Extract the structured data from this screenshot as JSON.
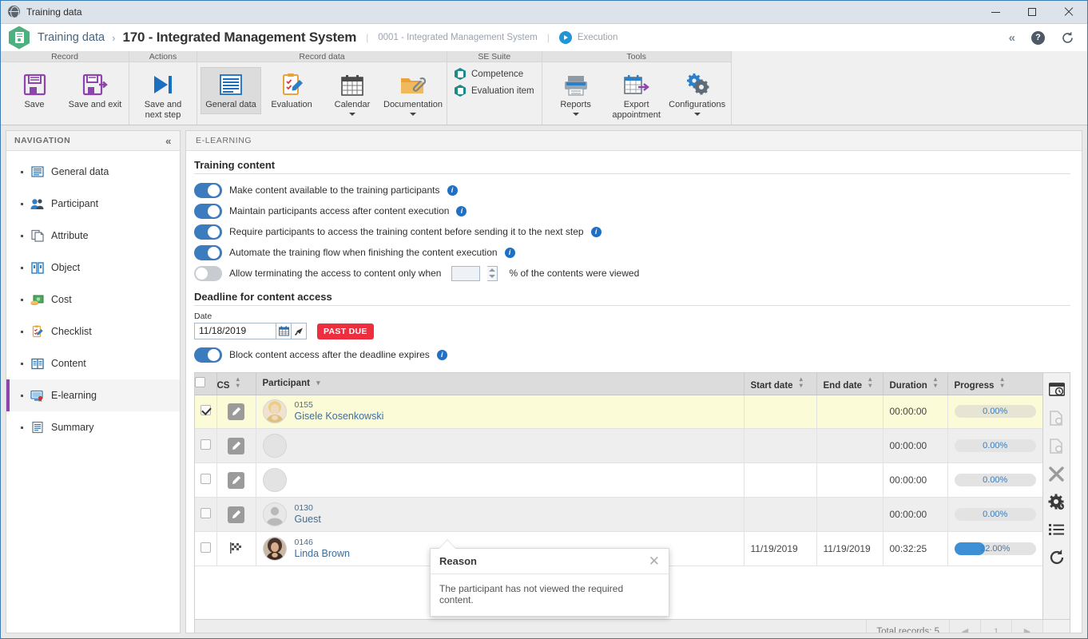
{
  "window": {
    "title": "Training data",
    "icon": "globe-icon",
    "minimize": "minimize",
    "maximize": "maximize",
    "close": "close"
  },
  "header": {
    "breadcrumb_root": "Training data",
    "separator": "›",
    "title": "170 - Integrated Management System",
    "pipe": "|",
    "subtitle": "0001 - Integrated Management System",
    "pipe2": "|",
    "status": "Execution",
    "icons": [
      "chevron-up-icon",
      "help-icon",
      "refresh-icon"
    ]
  },
  "ribbon": {
    "groups": [
      {
        "caption": "Record",
        "buttons": [
          {
            "label": "Save",
            "icon": "save-icon",
            "dropdown": false
          },
          {
            "label": "Save and exit",
            "icon": "save-and-exit-icon",
            "dropdown": false
          }
        ]
      },
      {
        "caption": "Actions",
        "buttons": [
          {
            "label": "Save and next step",
            "icon": "next-step-icon",
            "dropdown": false
          }
        ]
      },
      {
        "caption": "Record data",
        "buttons": [
          {
            "label": "General data",
            "icon": "general-data-icon",
            "dropdown": false,
            "active": true
          },
          {
            "label": "Evaluation",
            "icon": "evaluation-icon",
            "dropdown": false
          },
          {
            "label": "Calendar",
            "icon": "calendar-icon",
            "dropdown": true
          },
          {
            "label": "Documentation",
            "icon": "documentation-icon",
            "dropdown": true
          }
        ]
      },
      {
        "caption": "SE Suite",
        "small_buttons": [
          {
            "label": "Competence",
            "icon": "competence-icon"
          },
          {
            "label": "Evaluation item",
            "icon": "evaluation-item-icon"
          }
        ]
      },
      {
        "caption": "Tools",
        "buttons": [
          {
            "label": "Reports",
            "icon": "reports-icon",
            "dropdown": true
          },
          {
            "label": "Export appointment",
            "icon": "export-appointment-icon",
            "dropdown": false
          },
          {
            "label": "Configurations",
            "icon": "configurations-icon",
            "dropdown": true
          }
        ]
      }
    ]
  },
  "navigation": {
    "title": "NAVIGATION",
    "collapse_icon": "collapse-icon",
    "items": [
      {
        "label": "General data",
        "icon": "general-data-icon",
        "active": false
      },
      {
        "label": "Participant",
        "icon": "participant-icon",
        "active": false
      },
      {
        "label": "Attribute",
        "icon": "attribute-icon",
        "active": false
      },
      {
        "label": "Object",
        "icon": "object-icon",
        "active": false
      },
      {
        "label": "Cost",
        "icon": "cost-icon",
        "active": false
      },
      {
        "label": "Checklist",
        "icon": "checklist-icon",
        "active": false
      },
      {
        "label": "Content",
        "icon": "content-icon",
        "active": false
      },
      {
        "label": "E-learning",
        "icon": "elearning-icon",
        "active": true
      },
      {
        "label": "Summary",
        "icon": "summary-icon",
        "active": false
      }
    ]
  },
  "panel": {
    "tab_label": "E-LEARNING",
    "section_training_content": "Training content",
    "toggles": [
      {
        "label": "Make content available to the training participants",
        "on": true,
        "info": true
      },
      {
        "label": "Maintain participants access after content execution",
        "on": true,
        "info": true
      },
      {
        "label": "Require participants to access the training content before sending it to the next step",
        "on": true,
        "info": true
      },
      {
        "label": "Automate the training flow when finishing the content execution",
        "on": true,
        "info": true
      }
    ],
    "percent_rule": {
      "on": false,
      "label_before": "Allow terminating the access to content only when",
      "value": "",
      "label_after": "% of the contents were viewed"
    },
    "section_deadline": "Deadline for content access",
    "date_label": "Date",
    "date_value": "11/18/2019",
    "date_icons": [
      "calendar-picker-icon",
      "clear-date-icon"
    ],
    "past_due_badge": "PAST DUE",
    "block_toggle": {
      "label": "Block content access after the deadline expires",
      "on": true,
      "info": true
    }
  },
  "grid": {
    "columns": [
      {
        "key": "checkbox",
        "label": "",
        "sortable": false
      },
      {
        "key": "cs",
        "label": "CS",
        "sortable": true
      },
      {
        "key": "participant",
        "label": "Participant",
        "sortable": true,
        "sorted": "asc"
      },
      {
        "key": "start_date",
        "label": "Start date",
        "sortable": true
      },
      {
        "key": "end_date",
        "label": "End date",
        "sortable": true
      },
      {
        "key": "duration",
        "label": "Duration",
        "sortable": true
      },
      {
        "key": "progress",
        "label": "Progress",
        "sortable": true
      }
    ],
    "rows": [
      {
        "selected": true,
        "cs_icon": "pencil-icon",
        "code": "0155",
        "name": "Gisele Kosenkowski",
        "avatar": "photo-female-blonde",
        "start_date": "",
        "end_date": "",
        "duration": "00:00:00",
        "progress_label": "0.00%",
        "progress_value": 0,
        "style": "sel"
      },
      {
        "selected": false,
        "cs_icon": "pencil-icon",
        "code": "",
        "name": "",
        "avatar": "photo-hidden",
        "start_date": "",
        "end_date": "",
        "duration": "00:00:00",
        "progress_label": "0.00%",
        "progress_value": 0,
        "style": "alt"
      },
      {
        "selected": false,
        "cs_icon": "pencil-icon",
        "code": "",
        "name": "",
        "avatar": "photo-hidden",
        "start_date": "",
        "end_date": "",
        "duration": "00:00:00",
        "progress_label": "0.00%",
        "progress_value": 0,
        "style": "plain"
      },
      {
        "selected": false,
        "cs_icon": "pencil-icon",
        "code": "0130",
        "name": "Guest",
        "avatar": "placeholder-person",
        "start_date": "",
        "end_date": "",
        "duration": "00:00:00",
        "progress_label": "0.00%",
        "progress_value": 0,
        "style": "alt"
      },
      {
        "selected": false,
        "cs_icon": "flag-icon",
        "code": "0146",
        "name": "Linda Brown",
        "avatar": "photo-female-brunette",
        "start_date": "11/19/2019",
        "end_date": "11/19/2019",
        "duration": "00:32:25",
        "progress_label": "22.00%",
        "progress_value": 22,
        "style": "plain"
      }
    ],
    "side_tools": [
      {
        "icon": "preview-window-icon",
        "dim": false
      },
      {
        "icon": "document-add-icon",
        "dim": true
      },
      {
        "icon": "document-view-icon",
        "dim": true
      },
      {
        "icon": "delete-icon",
        "dim": false
      },
      {
        "icon": "settings-gear-icon",
        "dim": false
      },
      {
        "icon": "list-icon",
        "dim": false
      },
      {
        "icon": "refresh-icon",
        "dim": false
      }
    ],
    "footer": {
      "total_label": "Total records: 5",
      "prev": "◀",
      "page": "1",
      "next": "▶"
    }
  },
  "popup": {
    "title": "Reason",
    "close_icon": "close-icon",
    "message": "The participant has not viewed the required content."
  },
  "colors": {
    "accent_blue": "#3c7cbe",
    "past_due_red": "#ed2e3f",
    "selected_row": "#fcfbd7",
    "nav_active_bar": "#8e44ad",
    "logo_green": "#4eb07f"
  }
}
